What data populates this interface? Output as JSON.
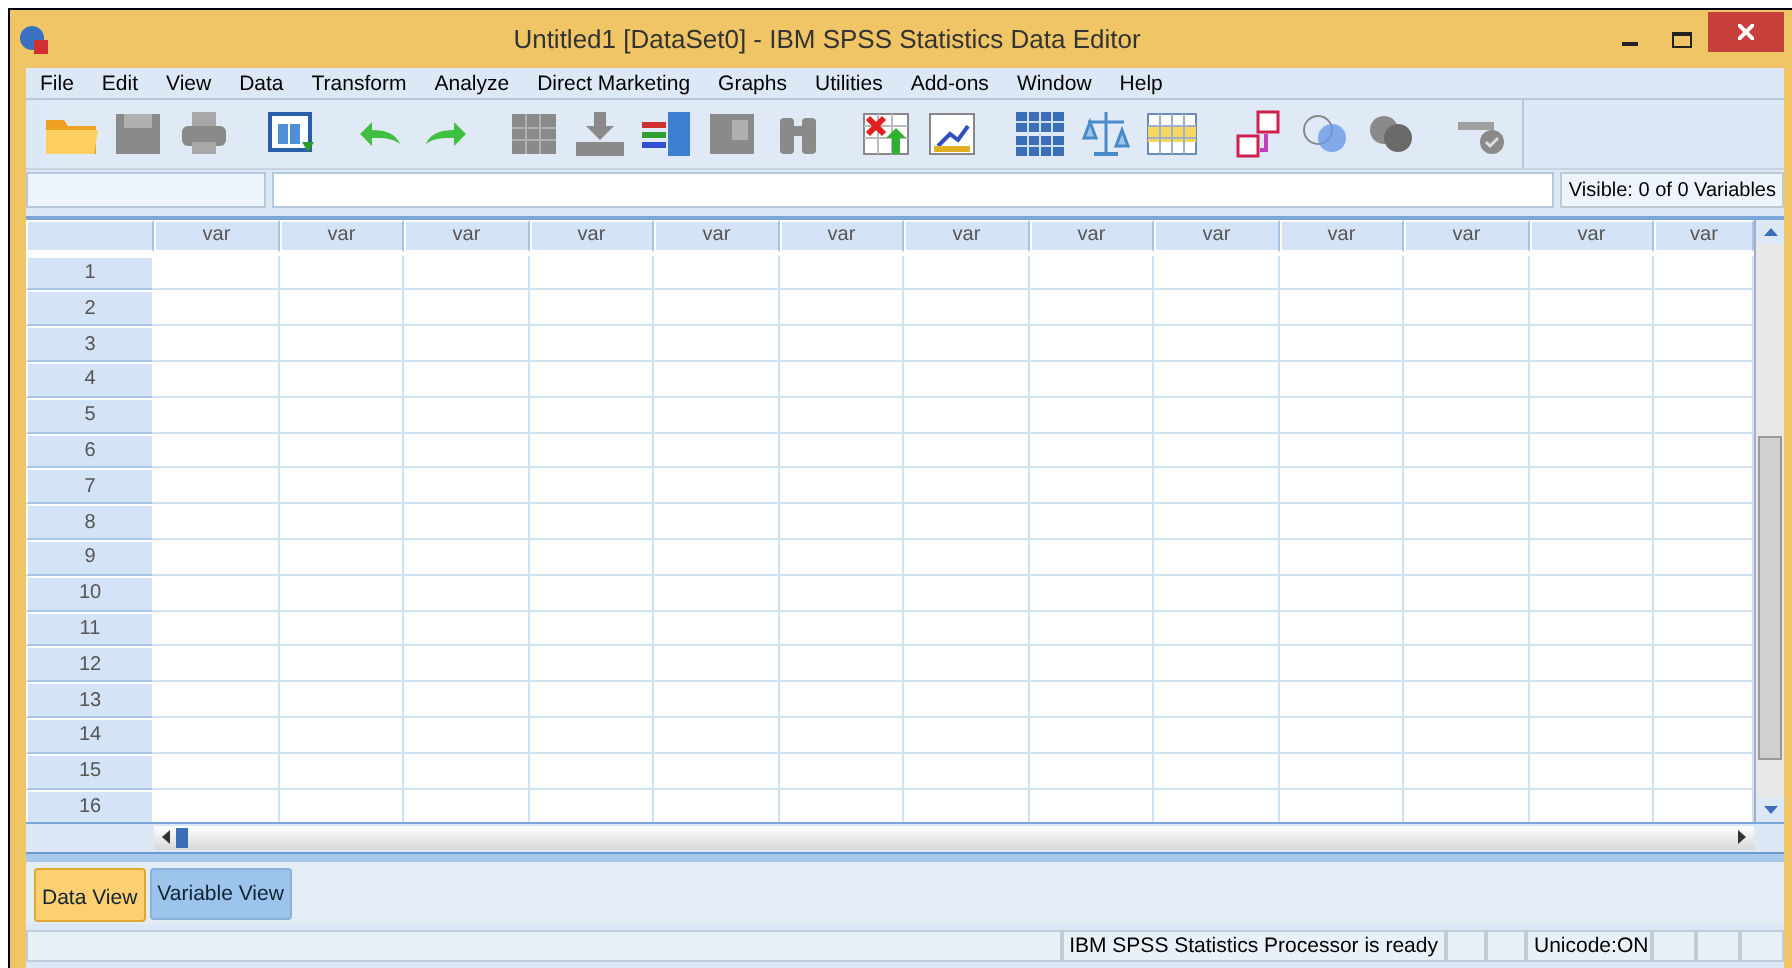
{
  "window": {
    "title": "Untitled1 [DataSet0] - IBM SPSS Statistics Data Editor"
  },
  "menu": [
    "File",
    "Edit",
    "View",
    "Data",
    "Transform",
    "Analyze",
    "Direct Marketing",
    "Graphs",
    "Utilities",
    "Add-ons",
    "Window",
    "Help"
  ],
  "visible_variables": "Visible: 0 of 0 Variables",
  "grid": {
    "columns": [
      "var",
      "var",
      "var",
      "var",
      "var",
      "var",
      "var",
      "var",
      "var",
      "var",
      "var",
      "var",
      "var"
    ],
    "rows": [
      "1",
      "2",
      "3",
      "4",
      "5",
      "6",
      "7",
      "8",
      "9",
      "10",
      "11",
      "12",
      "13",
      "14",
      "15",
      "16"
    ]
  },
  "tabs": [
    {
      "label": "Data View",
      "selected": true
    },
    {
      "label": "Variable View",
      "selected": false
    }
  ],
  "status_bar": [
    "IBM SPSS Statistics Processor is ready",
    "Unicode:ON"
  ]
}
